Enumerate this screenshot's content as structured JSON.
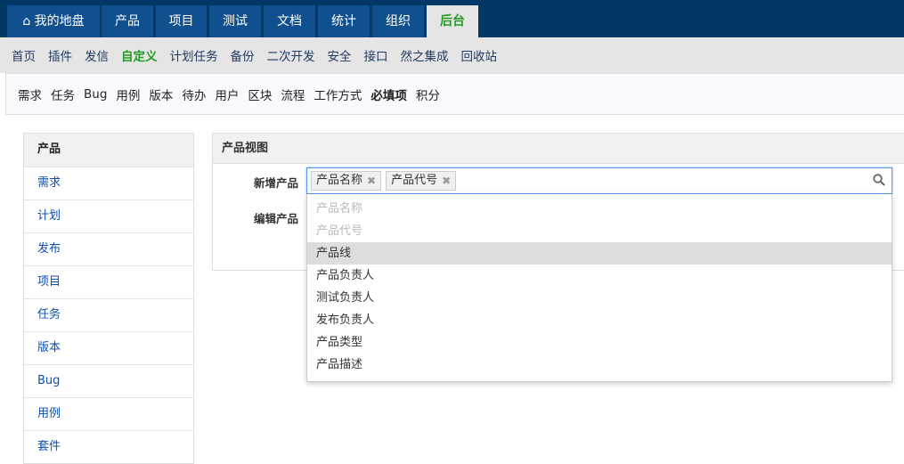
{
  "topnav": {
    "tabs": [
      {
        "label": "我的地盘",
        "icon": "home-icon"
      },
      {
        "label": "产品"
      },
      {
        "label": "项目"
      },
      {
        "label": "测试"
      },
      {
        "label": "文档"
      },
      {
        "label": "统计"
      },
      {
        "label": "组织"
      },
      {
        "label": "后台"
      }
    ],
    "active": "后台"
  },
  "subnav": [
    "首页",
    "插件",
    "发信",
    "自定义",
    "计划任务",
    "备份",
    "二次开发",
    "安全",
    "接口",
    "然之集成",
    "回收站"
  ],
  "menubar": [
    "需求",
    "任务",
    "Bug",
    "用例",
    "版本",
    "待办",
    "用户",
    "区块",
    "流程",
    "工作方式",
    "必填项",
    "积分"
  ],
  "sidebar": {
    "title": "产品",
    "items": [
      "需求",
      "计划",
      "发布",
      "项目",
      "任务",
      "版本",
      "Bug",
      "用例",
      "套件"
    ]
  },
  "panel": {
    "title": "产品视图",
    "create_label": "新增产品",
    "edit_label": "编辑产品",
    "selected": [
      "产品名称",
      "产品代号"
    ],
    "options": [
      "产品名称",
      "产品代号",
      "产品线",
      "产品负责人",
      "测试负责人",
      "发布负责人",
      "产品类型",
      "产品描述"
    ]
  }
}
